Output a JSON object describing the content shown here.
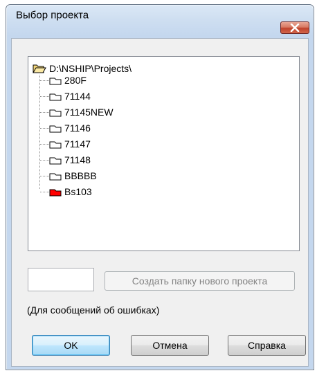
{
  "window": {
    "title": "Выбор проекта"
  },
  "tree": {
    "root": {
      "label": "D:\\NSHIP\\Projects\\",
      "icon": "folder-open-icon"
    },
    "items": [
      {
        "label": "280F",
        "icon": "folder-icon",
        "selected": false
      },
      {
        "label": "71144",
        "icon": "folder-icon",
        "selected": false
      },
      {
        "label": "71145NEW",
        "icon": "folder-icon",
        "selected": false
      },
      {
        "label": "71146",
        "icon": "folder-icon",
        "selected": false
      },
      {
        "label": "71147",
        "icon": "folder-icon",
        "selected": false
      },
      {
        "label": "71148",
        "icon": "folder-icon",
        "selected": false
      },
      {
        "label": "BBBBB",
        "icon": "folder-icon",
        "selected": false
      },
      {
        "label": "Bs103",
        "icon": "folder-icon",
        "selected": true
      }
    ]
  },
  "project_name_input": {
    "value": ""
  },
  "create_folder_button": {
    "label": "Создать папку нового проекта",
    "disabled": true
  },
  "status": {
    "text": "(Для сообщений об ошибках)"
  },
  "buttons": {
    "ok": "OK",
    "cancel": "Отмена",
    "help": "Справка"
  },
  "colors": {
    "selected_folder": "#ff0000",
    "folder_outline": "#000000",
    "open_folder_fill": "#f5d77a"
  }
}
